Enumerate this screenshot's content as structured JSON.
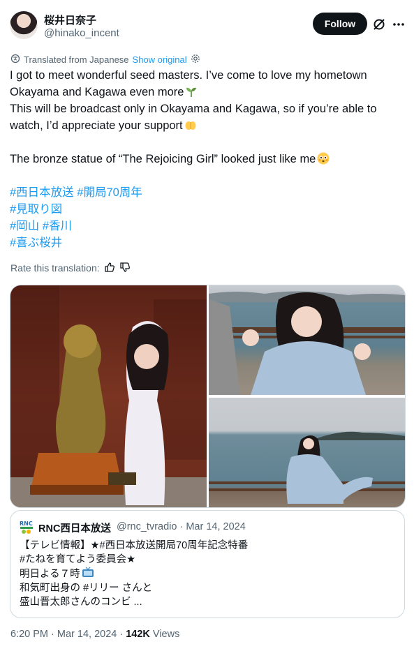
{
  "author": {
    "display_name": "桜井日奈子",
    "handle": "@hinako_incent",
    "follow_label": "Follow"
  },
  "translation": {
    "label": "Translated from Japanese",
    "show_original": "Show original"
  },
  "post": {
    "lines": [
      "I got to meet wonderful seed masters. I’ve come to love my hometown",
      "Okayama and Kagawa even more",
      "This will be broadcast only in Okayama and Kagawa, so if you’re able to",
      "watch, I’d appreciate your support",
      "The bronze statue of “The Rejoicing Girl” looked just like me"
    ],
    "hashtags": [
      "#西日本放送",
      "#開局70周年",
      "#見取り図",
      "#岡山",
      "#香川",
      "#喜ぶ桜井"
    ]
  },
  "rate": {
    "label": "Rate this translation:"
  },
  "media": {
    "images": [
      "bronze-statue-photo",
      "waving-by-sea-photo",
      "seaside-pose-photo"
    ]
  },
  "quote": {
    "name": "RNC西日本放送",
    "handle_date": "@rnc_tvradio · Mar 14, 2024",
    "lines": [
      "【テレビ情報】★#西日本放送開局70周年記念特番",
      "#たねを育てよう委員会★",
      "明日よる７時",
      "和気町出身の #リリー さんと",
      "盛山晋太郎さんのコンビ ..."
    ]
  },
  "footer": {
    "time_date": "6:20 PM · Mar 14, 2024 · ",
    "views_count": "142K",
    "views_label": " Views"
  },
  "colors": {
    "accent": "#1d9bf0",
    "text": "#0f1419",
    "muted": "#536471",
    "border": "#cfd9de"
  }
}
